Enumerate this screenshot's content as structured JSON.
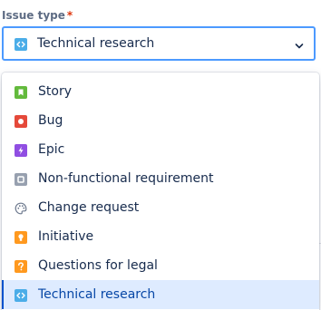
{
  "field": {
    "label": "Issue type",
    "required_marker": "*"
  },
  "select": {
    "value": "Technical research",
    "icon": "technical-research-icon"
  },
  "menu": {
    "items": [
      {
        "label": "Story",
        "icon": "story-icon",
        "color": "#63ba3c"
      },
      {
        "label": "Bug",
        "icon": "bug-icon",
        "color": "#e5493a"
      },
      {
        "label": "Epic",
        "icon": "epic-icon",
        "color": "#904ee2"
      },
      {
        "label": "Non-functional requirement",
        "icon": "non-functional-requirement-icon",
        "color": "#97a0af"
      },
      {
        "label": "Change request",
        "icon": "change-request-icon",
        "color": "#6b778c"
      },
      {
        "label": "Initiative",
        "icon": "initiative-icon",
        "color": "#ff991f"
      },
      {
        "label": "Questions for legal",
        "icon": "questions-for-legal-icon",
        "color": "#ff991f"
      },
      {
        "label": "Technical research",
        "icon": "technical-research-icon",
        "color": "#4bade8",
        "selected": true
      }
    ]
  },
  "colors": {
    "label": "#5e6c84",
    "required": "#de350b",
    "focus_border": "#4c9aff",
    "selected_bg": "#deebff",
    "text": "#172b4d"
  }
}
